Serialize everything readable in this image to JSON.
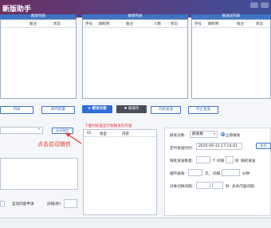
{
  "app": {
    "title": "新版助手"
  },
  "panels": {
    "left": {
      "header": "群发列表",
      "columns": [
        "备注",
        "状态"
      ],
      "buttons": [
        "列表",
        "保存配置"
      ]
    },
    "middle": {
      "header": "群组列表",
      "columns": [
        "序号",
        "群昵称",
        "备注",
        "人数",
        "状态"
      ]
    },
    "right": {
      "header": "群发员列表",
      "columns": [
        "序号",
        "群昵称",
        "备注",
        "状态"
      ]
    }
  },
  "toolbar": {
    "send_label": "群发内容",
    "group_op_label": "群操作",
    "start_label": "开始发送",
    "stop_label": "停止发送"
  },
  "left_lower": {
    "auto_wechat_label": "启动微信",
    "annotation": "点击启动微信",
    "auto_reply_label": "自动同意申请",
    "interval_label": "间隔(秒)"
  },
  "content_area": {
    "title": "下面列表里显示要群发的内容",
    "columns": [
      "ID",
      "类型",
      "内容"
    ]
  },
  "settings": {
    "target_label": "群发对象:",
    "target_value": "群发群",
    "immediate_label": "立即群发",
    "schedule_label": "定时发送时间:",
    "schedule_value": "2025-05-31 17:14:41",
    "use_label": "使用",
    "every_label": "每批发送数量:",
    "every_unit": "个",
    "interval_mid": "间隔",
    "interval_unit": "秒",
    "random_label": "随机发送",
    "loop_label": "循环群发:",
    "loop_unit": "次,",
    "loop_mid": "间隔",
    "loop_unit2": "分钟",
    "switch_label": "对象切换间隔:",
    "switch_unit": "秒",
    "multi_label": "多条内容间隔:"
  }
}
